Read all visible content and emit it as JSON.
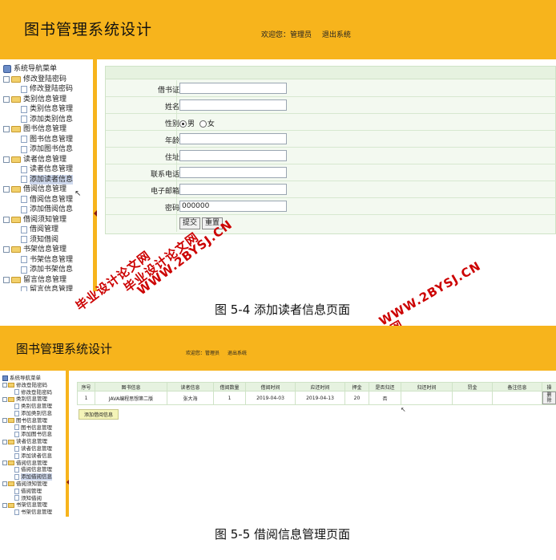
{
  "shot1": {
    "title": "图书管理系统设计",
    "welcome": "欢迎您：管理员",
    "logout": "退出系统",
    "tree": [
      {
        "label": "系统导航菜单",
        "level": 0,
        "kind": "root"
      },
      {
        "label": "修改登陆密码",
        "level": 1,
        "kind": "folder"
      },
      {
        "label": "修改登陆密码",
        "level": 2,
        "kind": "doc"
      },
      {
        "label": "类别信息管理",
        "level": 1,
        "kind": "folder"
      },
      {
        "label": "类别信息管理",
        "level": 2,
        "kind": "doc"
      },
      {
        "label": "添加类别信息",
        "level": 2,
        "kind": "doc"
      },
      {
        "label": "图书信息管理",
        "level": 1,
        "kind": "folder"
      },
      {
        "label": "图书信息管理",
        "level": 2,
        "kind": "doc"
      },
      {
        "label": "添加图书信息",
        "level": 2,
        "kind": "doc"
      },
      {
        "label": "读者信息管理",
        "level": 1,
        "kind": "folder"
      },
      {
        "label": "读者信息管理",
        "level": 2,
        "kind": "doc"
      },
      {
        "label": "添加读者信息",
        "level": 2,
        "kind": "doc",
        "selected": true
      },
      {
        "label": "借阅信息管理",
        "level": 1,
        "kind": "folder"
      },
      {
        "label": "借阅信息管理",
        "level": 2,
        "kind": "doc"
      },
      {
        "label": "添加借阅信息",
        "level": 2,
        "kind": "doc"
      },
      {
        "label": "借阅须知管理",
        "level": 1,
        "kind": "folder"
      },
      {
        "label": "借阅管理",
        "level": 2,
        "kind": "doc"
      },
      {
        "label": "须知借阅",
        "level": 2,
        "kind": "doc"
      },
      {
        "label": "书架信息管理",
        "level": 1,
        "kind": "folder"
      },
      {
        "label": "书架信息管理",
        "level": 2,
        "kind": "doc"
      },
      {
        "label": "添加书架信息",
        "level": 2,
        "kind": "doc"
      },
      {
        "label": "留言信息管理",
        "level": 1,
        "kind": "folder"
      },
      {
        "label": "留言信息管理",
        "level": 2,
        "kind": "doc"
      }
    ],
    "form": {
      "card_label": "借书证：",
      "name_label": "姓名：",
      "gender_label": "性别：",
      "gender_male": "男",
      "gender_female": "女",
      "age_label": "年龄：",
      "address_label": "住址：",
      "phone_label": "联系电话：",
      "email_label": "电子邮箱：",
      "password_label": "密码：",
      "password_value": "000000",
      "submit": "提交",
      "reset": "重置"
    },
    "caption": "图 5-4 添加读者信息页面"
  },
  "watermarks": {
    "site_a": "毕业设计论文网",
    "site_b": "WWW.2BYSJ.CN"
  },
  "shot2": {
    "title": "图书管理系统设计",
    "welcome": "欢迎您：管理员",
    "logout": "退出系统",
    "tree": [
      {
        "label": "系统导航菜单",
        "level": 0,
        "kind": "root"
      },
      {
        "label": "修改登陆密码",
        "level": 1,
        "kind": "folder"
      },
      {
        "label": "修改登陆密码",
        "level": 2,
        "kind": "doc"
      },
      {
        "label": "类别信息管理",
        "level": 1,
        "kind": "folder"
      },
      {
        "label": "类别信息管理",
        "level": 2,
        "kind": "doc"
      },
      {
        "label": "添加类别信息",
        "level": 2,
        "kind": "doc"
      },
      {
        "label": "图书信息管理",
        "level": 1,
        "kind": "folder"
      },
      {
        "label": "图书信息管理",
        "level": 2,
        "kind": "doc"
      },
      {
        "label": "添加图书信息",
        "level": 2,
        "kind": "doc"
      },
      {
        "label": "读者信息管理",
        "level": 1,
        "kind": "folder"
      },
      {
        "label": "读者信息管理",
        "level": 2,
        "kind": "doc"
      },
      {
        "label": "添加读者信息",
        "level": 2,
        "kind": "doc"
      },
      {
        "label": "借阅信息管理",
        "level": 1,
        "kind": "folder"
      },
      {
        "label": "借阅信息管理",
        "level": 2,
        "kind": "doc"
      },
      {
        "label": "添加借阅信息",
        "level": 2,
        "kind": "doc",
        "selected": true
      },
      {
        "label": "借阅须知管理",
        "level": 1,
        "kind": "folder"
      },
      {
        "label": "借阅管理",
        "level": 2,
        "kind": "doc"
      },
      {
        "label": "须知借阅",
        "level": 2,
        "kind": "doc"
      },
      {
        "label": "书架信息管理",
        "level": 1,
        "kind": "folder"
      },
      {
        "label": "书架信息管理",
        "level": 2,
        "kind": "doc"
      }
    ],
    "table": {
      "headers": [
        "序号",
        "图书信息",
        "读者信息",
        "借阅数量",
        "借阅时间",
        "应还时间",
        "押金",
        "是否归还",
        "归还时间",
        "罚金",
        "备注信息",
        "操"
      ],
      "rows": [
        [
          "1",
          "JAVA编程思想第二版",
          "张大海",
          "1",
          "2019-04-03",
          "2019-04-13",
          "20",
          "否",
          "",
          "",
          "",
          "删除"
        ]
      ]
    },
    "add_button": "添加借阅信息",
    "caption": "图 5-5 借阅信息管理页面"
  }
}
